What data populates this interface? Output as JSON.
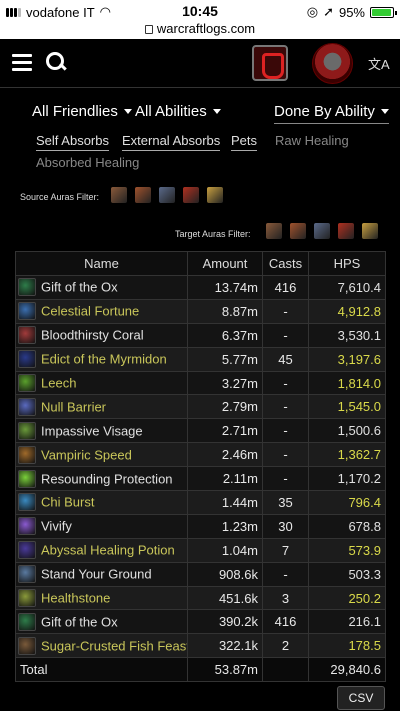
{
  "status_bar": {
    "carrier": "vodafone IT",
    "time": "10:45",
    "battery": "95%",
    "battery_level": 0.95
  },
  "url": "warcraftlogs.com",
  "header": {
    "translate_icon": "translate-icon"
  },
  "filters": {
    "friendlies": "All Friendlies",
    "abilities": "All Abilities",
    "done_by": "Done By Ability"
  },
  "tabs": [
    "Self Absorbs",
    "External Absorbs",
    "Pets",
    "Raw Healing",
    "Absorbed Healing"
  ],
  "source_auras_label": "Source Auras Filter:",
  "target_auras_label": "Target Auras Filter:",
  "aura_colors": [
    "#8a5a3a",
    "#a0522d",
    "#5a6a8a",
    "#b03020",
    "#c8a040"
  ],
  "table": {
    "headers": [
      "Name",
      "Amount",
      "Casts",
      "HPS"
    ],
    "rows": [
      {
        "name": "Gift of the Ox",
        "amount": "13.74m",
        "casts": "416",
        "hps": "7,610.4",
        "icon": "#2e7d4a"
      },
      {
        "name": "Celestial Fortune",
        "amount": "8.87m",
        "casts": "-",
        "hps": "4,912.8",
        "icon": "#3b6fb0"
      },
      {
        "name": "Bloodthirsty Coral",
        "amount": "6.37m",
        "casts": "-",
        "hps": "3,530.1",
        "icon": "#a23b3b"
      },
      {
        "name": "Edict of the Myrmidon",
        "amount": "5.77m",
        "casts": "45",
        "hps": "3,197.6",
        "icon": "#2a3a8a"
      },
      {
        "name": "Leech",
        "amount": "3.27m",
        "casts": "-",
        "hps": "1,814.0",
        "icon": "#5aa02c"
      },
      {
        "name": "Null Barrier",
        "amount": "2.79m",
        "casts": "-",
        "hps": "1,545.0",
        "icon": "#5a6ac0"
      },
      {
        "name": "Impassive Visage",
        "amount": "2.71m",
        "casts": "-",
        "hps": "1,500.6",
        "icon": "#6a9a3a"
      },
      {
        "name": "Vampiric Speed",
        "amount": "2.46m",
        "casts": "-",
        "hps": "1,362.7",
        "icon": "#a06a2a"
      },
      {
        "name": "Resounding Protection",
        "amount": "2.11m",
        "casts": "-",
        "hps": "1,170.2",
        "icon": "#7ad03a"
      },
      {
        "name": "Chi Burst",
        "amount": "1.44m",
        "casts": "35",
        "hps": "796.4",
        "icon": "#3a8ac0"
      },
      {
        "name": "Vivify",
        "amount": "1.23m",
        "casts": "30",
        "hps": "678.8",
        "icon": "#8a5ad0"
      },
      {
        "name": "Abyssal Healing Potion",
        "amount": "1.04m",
        "casts": "7",
        "hps": "573.9",
        "icon": "#4a3a9a"
      },
      {
        "name": "Stand Your Ground",
        "amount": "908.6k",
        "casts": "-",
        "hps": "503.3",
        "icon": "#5a7aa0"
      },
      {
        "name": "Healthstone",
        "amount": "451.6k",
        "casts": "3",
        "hps": "250.2",
        "icon": "#8a9a3a"
      },
      {
        "name": "Gift of the Ox",
        "amount": "390.2k",
        "casts": "416",
        "hps": "216.1",
        "icon": "#2e7d4a"
      },
      {
        "name": "Sugar-Crusted Fish Feast",
        "amount": "322.1k",
        "casts": "2",
        "hps": "178.5",
        "icon": "#7a5a3a"
      }
    ],
    "total": {
      "label": "Total",
      "amount": "53.87m",
      "casts": "",
      "hps": "29,840.6"
    }
  },
  "csv_label": "CSV"
}
